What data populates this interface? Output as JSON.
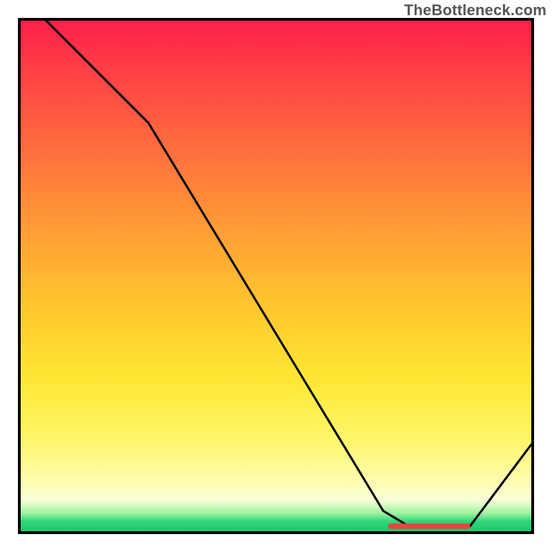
{
  "watermark": "TheBottleneck.com",
  "chart_data": {
    "type": "line",
    "title": "",
    "xlabel": "",
    "ylabel": "",
    "xlim": [
      0,
      100
    ],
    "ylim": [
      0,
      100
    ],
    "grid": false,
    "legend": false,
    "series": [
      {
        "name": "curve",
        "color": "#000000",
        "x": [
          5,
          25,
          71,
          76,
          88,
          100
        ],
        "y": [
          100,
          80,
          4,
          1,
          1,
          17
        ]
      }
    ],
    "marker": {
      "name": "optimum-band",
      "color": "#e5463f",
      "x_start": 72,
      "x_end": 88,
      "y": 1
    },
    "background_gradient": {
      "stops": [
        {
          "pos": 0,
          "color": "#ff1f4a"
        },
        {
          "pos": 0.08,
          "color": "#ff3a46"
        },
        {
          "pos": 0.24,
          "color": "#ff6a3e"
        },
        {
          "pos": 0.4,
          "color": "#ff9a36"
        },
        {
          "pos": 0.56,
          "color": "#ffc72e"
        },
        {
          "pos": 0.7,
          "color": "#ffe733"
        },
        {
          "pos": 0.82,
          "color": "#fff66a"
        },
        {
          "pos": 0.9,
          "color": "#fffcae"
        },
        {
          "pos": 0.94,
          "color": "#f6ffd7"
        },
        {
          "pos": 0.965,
          "color": "#9cf29e"
        },
        {
          "pos": 0.98,
          "color": "#32d77a"
        },
        {
          "pos": 1.0,
          "color": "#22c46e"
        }
      ]
    }
  }
}
